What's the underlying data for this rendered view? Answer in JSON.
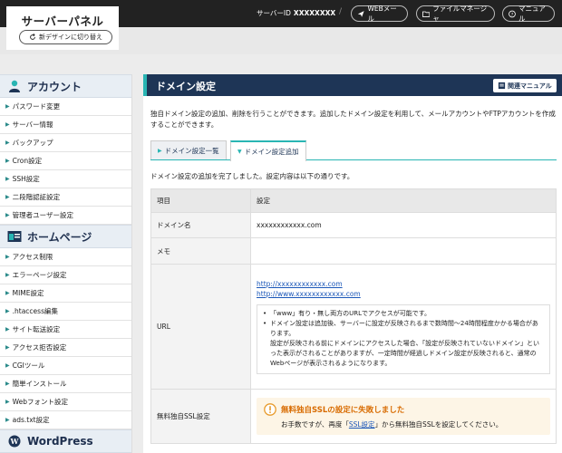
{
  "header": {
    "logo": "サーバーパネル",
    "new_design": "新デザインに切り替え",
    "server_id_label": "サーバーID",
    "server_id_value": "XXXXXXXX",
    "separator": "/",
    "webmail": "WEBメール",
    "file_manager": "ファイルマネージャ",
    "manual": "マニュアル"
  },
  "sidebar": {
    "account": {
      "title": "アカウント",
      "items": [
        "パスワード変更",
        "サーバー情報",
        "バックアップ",
        "Cron設定",
        "SSH設定",
        "二段階認証設定",
        "管理者ユーザー設定"
      ]
    },
    "homepage": {
      "title": "ホームページ",
      "items": [
        "アクセス制限",
        "エラーページ設定",
        "MIME設定",
        ".htaccess編集",
        "サイト転送設定",
        "アクセス拒否設定",
        "CGIツール",
        "簡単インストール",
        "Webフォント設定",
        "ads.txt設定"
      ]
    },
    "wordpress": {
      "title": "WordPress"
    }
  },
  "main": {
    "title": "ドメイン設定",
    "manual_btn": "関連マニュアル",
    "intro": "独自ドメイン設定の追加、削除を行うことができます。追加したドメイン設定を利用して、メールアカウントやFTPアカウントを作成することができます。",
    "tabs": [
      "ドメイン設定一覧",
      "ドメイン設定追加"
    ],
    "done_msg": "ドメイン設定の追加を完了しました。設定内容は以下の通りです。",
    "table": {
      "col_item": "項目",
      "col_setting": "設定",
      "domain_label": "ドメイン名",
      "domain_value": "xxxxxxxxxxxx.com",
      "memo_label": "メモ",
      "memo_value": "",
      "url_label": "URL",
      "url1": "http://xxxxxxxxxxxx.com",
      "url2": "http://www.xxxxxxxxxxxx.com",
      "note1": "「www」有り・無し両方のURLでアクセスが可能です。",
      "note2": "ドメイン設定は追加後、サーバーに設定が反映されるまで数時間〜24時間程度かかる場合があります。",
      "note3": "設定が反映される前にドメインにアクセスした場合、「設定が反映されていないドメイン」といった表示がされることがありますが、一定時間が経過しドメイン設定が反映されると、通常のWebページが表示されるようになります。",
      "ssl_label": "無料独自SSL設定",
      "ssl_error_title": "無料独自SSLの設定に失敗しました",
      "ssl_error_pre": "お手数ですが、再度「",
      "ssl_error_link": "SSL設定",
      "ssl_error_post": "」から無料独自SSLを設定してください。"
    }
  },
  "colors": {
    "navy": "#1e3556",
    "teal": "#29b5b3",
    "error": "#d86b00"
  }
}
